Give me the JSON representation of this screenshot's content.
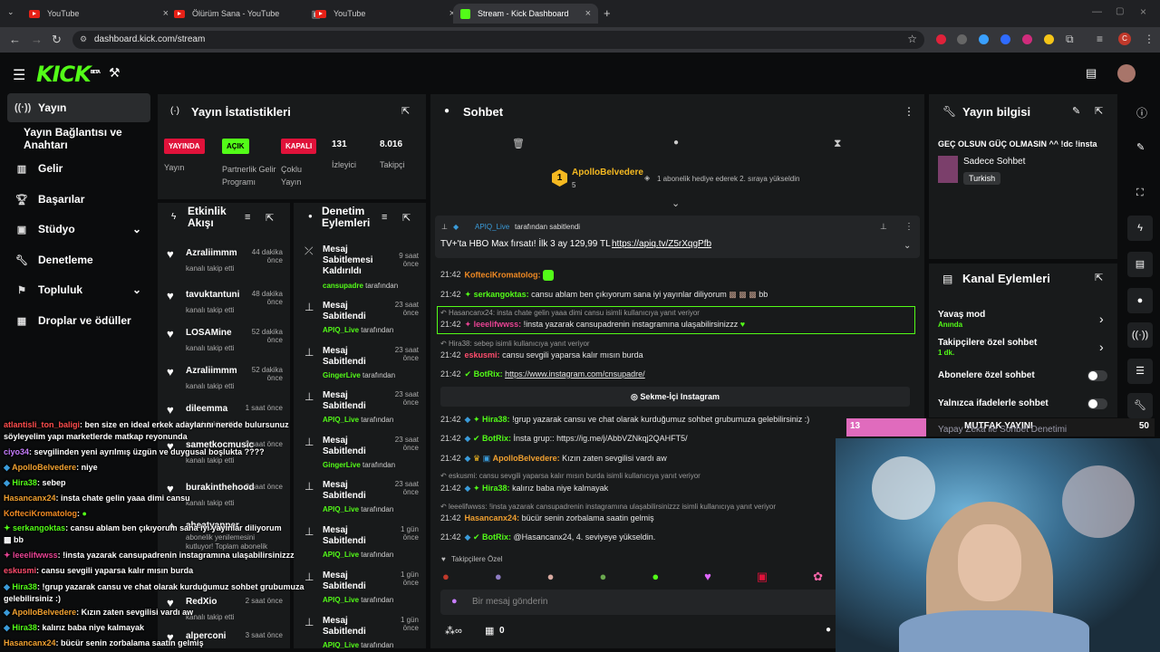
{
  "browser": {
    "tabs": [
      {
        "title": "YouTube"
      },
      {
        "title": "Ölürüm Sana - YouTube"
      },
      {
        "title": "YouTube"
      },
      {
        "title": "Stream - Kick Dashboard"
      }
    ],
    "url": "dashboard.kick.com/stream"
  },
  "kick": {
    "logo": "KICK",
    "beta": "BETA"
  },
  "sidebar": {
    "items": [
      {
        "label": "Yayın"
      },
      {
        "label": "Yayın Bağlantısı ve Anahtarı"
      },
      {
        "label": "Gelir"
      },
      {
        "label": "Başarılar"
      },
      {
        "label": "Stüdyo"
      },
      {
        "label": "Denetleme"
      },
      {
        "label": "Topluluk"
      },
      {
        "label": "Droplar ve ödüller"
      }
    ]
  },
  "stats": {
    "title": "Yayın İstatistikleri",
    "badges": [
      {
        "value": "YAYINDA",
        "label": "Yayın",
        "color": "#e0123a"
      },
      {
        "value": "AÇIK",
        "label": "Partnerlik Gelir Programı",
        "color": "#53fc18"
      },
      {
        "value": "KAPALI",
        "label": "Çoklu Yayın",
        "color": "#e0123a"
      }
    ],
    "viewers_value": "131",
    "viewers_label": "İzleyici",
    "followers_value": "8.016",
    "followers_label": "Takipçi"
  },
  "activity": {
    "title": "Etkinlik Akışı",
    "items": [
      {
        "name": "Azraliimmm",
        "sub": "kanalı takip etti",
        "time": "44 dakika önce"
      },
      {
        "name": "tavuktantuni",
        "sub": "kanalı takip etti",
        "time": "48 dakika önce"
      },
      {
        "name": "LOSAMine",
        "sub": "kanalı takip etti",
        "time": "52 dakika önce"
      },
      {
        "name": "Azraliimmm",
        "sub": "kanalı takip etti",
        "time": "52 dakika önce"
      },
      {
        "name": "dileemma",
        "sub": "kanalı takip etti",
        "time": "1 saat önce"
      },
      {
        "name": "sametkocmusic",
        "sub": "kanalı takip etti",
        "time": "2 saat önce"
      },
      {
        "name": "burakinthehood",
        "sub": "kanalı takip etti",
        "time": "2 saat önce"
      },
      {
        "name": "aheatyapper",
        "sub": "abonelik yenilemesini kutluyor! Toplam abonelik",
        "time": ""
      },
      {
        "name": "RedXio",
        "sub": "kanalı takip etti",
        "time": "2 saat önce"
      },
      {
        "name": "alperconi",
        "sub": "",
        "time": "3 saat önce"
      }
    ]
  },
  "modactions": {
    "title": "Denetim Eylemleri",
    "items": [
      {
        "action": "Mesaj Sabitlemesi Kaldırıldı",
        "by": "cansupadre",
        "suffix": "tarafından",
        "time": "9 saat önce"
      },
      {
        "action": "Mesaj Sabitlendi",
        "by": "APIQ_Live",
        "suffix": "tarafından",
        "time": "23 saat önce"
      },
      {
        "action": "Mesaj Sabitlendi",
        "by": "GingerLive",
        "suffix": "tarafından",
        "time": "23 saat önce"
      },
      {
        "action": "Mesaj Sabitlendi",
        "by": "APIQ_Live",
        "suffix": "tarafından",
        "time": "23 saat önce"
      },
      {
        "action": "Mesaj Sabitlendi",
        "by": "GingerLive",
        "suffix": "tarafından",
        "time": "23 saat önce"
      },
      {
        "action": "Mesaj Sabitlendi",
        "by": "APIQ_Live",
        "suffix": "tarafından",
        "time": "23 saat önce"
      },
      {
        "action": "Mesaj Sabitlendi",
        "by": "APIQ_Live",
        "suffix": "tarafından",
        "time": "1 gün önce"
      },
      {
        "action": "Mesaj Sabitlendi",
        "by": "APIQ_Live",
        "suffix": "tarafından",
        "time": "1 gün önce"
      },
      {
        "action": "Mesaj Sabitlendi",
        "by": "APIQ_Live",
        "suffix": "tarafından",
        "time": "1 gün önce"
      }
    ]
  },
  "chat": {
    "title": "Sohbet",
    "top_user": "ApolloBelvedere",
    "top_rank": "1",
    "top_count": "5",
    "top_event": "1 abonelik hediye ederek 2. sıraya yükseldin",
    "pinned_by": "APIQ_Live",
    "pinned_suffix": "tarafından sabitlendi",
    "pinned_text": "TV+'ta HBO Max fırsatı! İlk 3 ay 129,99 TL",
    "pinned_link": "https://apiq.tv/Z5rXqgPfb",
    "messages": [
      {
        "time": "21:42",
        "user": "KofteciKromatolog:",
        "color": "#f08a24",
        "text": ""
      },
      {
        "time": "21:42",
        "user": "serkangoktas:",
        "color": "#53fc18",
        "text": "cansu ablam ben çıkıyorum sana iyi yayınlar diliyorum",
        "tail": "bb"
      },
      {
        "time": "21:42",
        "user": "leeelifwwss:",
        "color": "#e84393",
        "text": "!insta yazarak cansupadrenin instagramına ulaşabilirsinizzz"
      },
      {
        "time": "21:42",
        "user": "eskusmi:",
        "color": "#ff4d6d",
        "text": "cansu sevgili yaparsa kalır mısın burda"
      },
      {
        "time": "21:42",
        "user": "BotRix:",
        "color": "#53fc18",
        "text": "https://www.instagram.com/cnsupadre/"
      },
      {
        "time": "21:42",
        "user": "Hira38:",
        "color": "#53fc18",
        "text": "!grup yazarak cansu ve chat olarak kurduğumuz sohbet grubumuza gelebilirsiniz :)"
      },
      {
        "time": "21:42",
        "user": "BotRix:",
        "color": "#53fc18",
        "text": "İnsta grup:: https://ig.me/j/AbbVZNkqj2QAHFT5/"
      },
      {
        "time": "21:42",
        "user": "ApolloBelvedere:",
        "color": "#f0a030",
        "text": "Kızın zaten sevgilisi vardı aw"
      },
      {
        "time": "21:42",
        "user": "Hira38:",
        "color": "#53fc18",
        "text": "kalırız baba niye kalmayak"
      },
      {
        "time": "21:42",
        "user": "Hasancanx24:",
        "color": "#f0a030",
        "text": "bücür senin zorbalama saatin gelmiş"
      },
      {
        "time": "21:42",
        "user": "BotRix:",
        "color": "#53fc18",
        "text": "@Hasancanx24, 4. seviyeye yükseldin."
      }
    ],
    "replies": [
      "Hasancanx24: insta chate gelin yaaa dimi cansu isimli kullanıcıya yanıt veriyor",
      "Hira38: sebep isimli kullanıcıya yanıt veriyor",
      "eskusmi: cansu sevgili yaparsa kalır mısın burda isimli kullanıcıya yanıt veriyor",
      "leeelifwwss: !insta yazarak cansupadrenin instagramına ulaşabilirsinizzz isimli kullanıcıya yanıt veriyor"
    ],
    "instagram_button": "Sekme-İçi Instagram",
    "followers_only": "Takipçilere Özel",
    "input_placeholder": "Bir mesaj gönderin",
    "points": "0"
  },
  "info": {
    "title": "Yayın bilgisi",
    "stream_title": "GEÇ OLSUN GÜÇ OLMASIN ^^ !dc !insta",
    "category": "Sadece Sohbet",
    "language": "Turkish"
  },
  "channel_actions": {
    "title": "Kanal Eylemleri",
    "items": [
      {
        "label": "Yavaş mod",
        "sub": "Anında"
      },
      {
        "label": "Takipçilere özel sohbet",
        "sub": "1 dk."
      },
      {
        "label": "Abonelere özel sohbet",
        "sub": ""
      },
      {
        "label": "Yalnızca ifadelerle sohbet",
        "sub": ""
      },
      {
        "label": "Yapay Zeka ile Sohbet Denetimi",
        "sub": ""
      }
    ]
  },
  "overlay_bar": {
    "left": "13",
    "title": "MUTFAK YAYINI",
    "right": "50"
  },
  "overlay_chat": [
    {
      "user": "atlantisli_ton_baligi",
      "color": "#ff4d4d",
      "text": ": ben size en ideal erkek adaylarını nerede bulursunuz söyleyelim yapı marketlerde matkap reyonunda"
    },
    {
      "user": "ciyo34",
      "color": "#c77dff",
      "text": ": sevgilinden yeni ayrılmış üzgün ve duygusal boşlukta ????"
    },
    {
      "user": "ApolloBelvedere",
      "color": "#f0a030",
      "text": ": niye"
    },
    {
      "user": "Hira38",
      "color": "#53fc18",
      "text": ": sebep"
    },
    {
      "user": "Hasancanx24",
      "color": "#f0a030",
      "text": ": insta chate gelin yaaa dimi cansu"
    },
    {
      "user": "KofteciKromatolog",
      "color": "#f08a24",
      "text": ":"
    },
    {
      "user": "serkangoktas",
      "color": "#53fc18",
      "text": ": cansu ablam ben çıkıyorum sana iyi yayınlar diliyorum"
    },
    {
      "user": "",
      "color": "#ffffff",
      "text": "bb"
    },
    {
      "user": "leeelifwwss",
      "color": "#e84393",
      "text": ": !insta yazarak cansupadrenin instagramına ulaşabilirsinizzz"
    },
    {
      "user": "eskusmi",
      "color": "#ff4d6d",
      "text": ": cansu sevgili yaparsa kalır mısın burda"
    },
    {
      "user": "Hira38",
      "color": "#53fc18",
      "text": ": !grup yazarak cansu ve chat olarak kurduğumuz sohbet grubumuza gelebilirsiniz :)"
    },
    {
      "user": "ApolloBelvedere",
      "color": "#f0a030",
      "text": ": Kızın zaten sevgilisi vardı aw"
    },
    {
      "user": "Hira38",
      "color": "#53fc18",
      "text": ": kalırız baba niye kalmayak"
    },
    {
      "user": "Hasancanx24",
      "color": "#f0a030",
      "text": ": bücür senin zorbalama saatin gelmiş"
    }
  ]
}
